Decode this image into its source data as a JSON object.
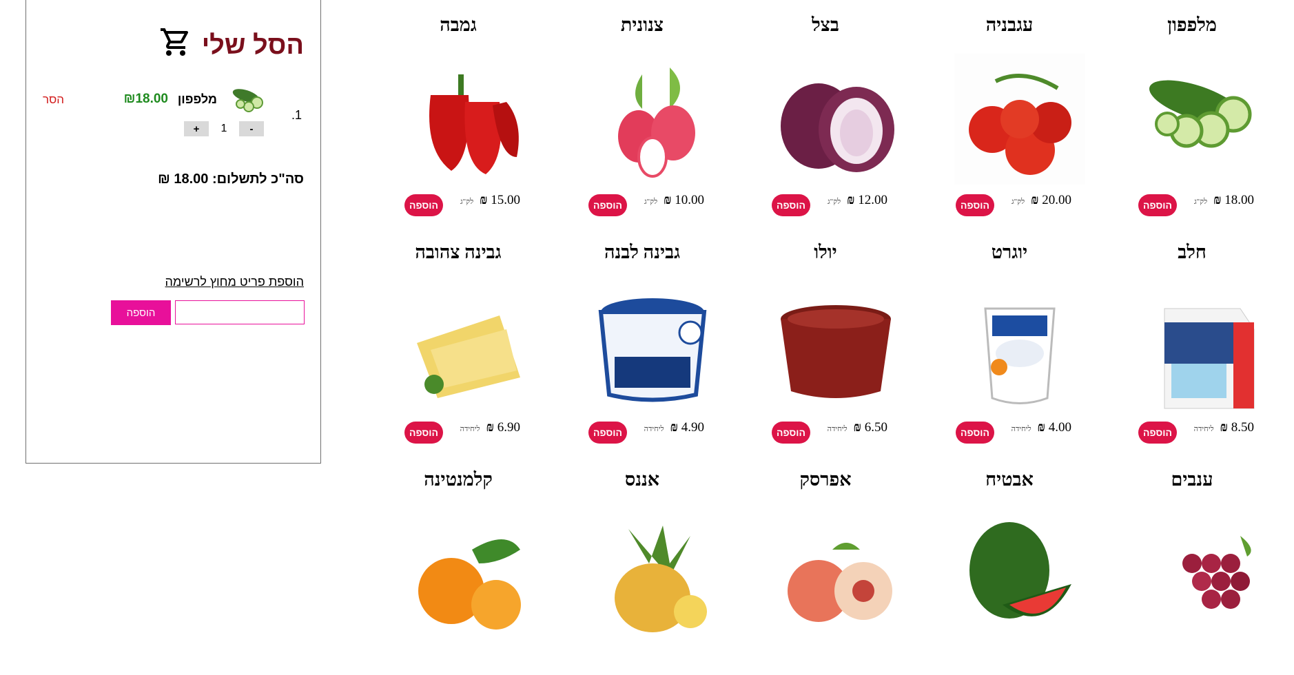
{
  "cart": {
    "title": "הסל שלי",
    "items": [
      {
        "index": "1.",
        "name": "מלפפון",
        "price": "₪18.00",
        "remove_label": "הסר",
        "quantity": "1",
        "minus": "-",
        "plus": "+"
      }
    ],
    "total_label": "סה\"כ לתשלום: 18.00 ₪",
    "extra_link": "הוספת פריט מחוץ לרשימה",
    "extra_input_value": "",
    "extra_button": "הוספה"
  },
  "currency": "₪",
  "add_label": "הוספה",
  "products": [
    {
      "name": "מלפפון",
      "price": "18.00",
      "unit": "לק\"ג",
      "icon": "cucumber-icon"
    },
    {
      "name": "עגבניה",
      "price": "20.00",
      "unit": "לק\"ג",
      "icon": "tomato-icon"
    },
    {
      "name": "בצל",
      "price": "12.00",
      "unit": "לק\"ג",
      "icon": "onion-icon"
    },
    {
      "name": "צנונית",
      "price": "10.00",
      "unit": "לק\"ג",
      "icon": "radish-icon"
    },
    {
      "name": "גמבה",
      "price": "15.00",
      "unit": "לק\"ג",
      "icon": "pepper-icon"
    },
    {
      "name": "חלב",
      "price": "8.50",
      "unit": "ליחידה",
      "icon": "milk-carton-icon"
    },
    {
      "name": "יוגרט",
      "price": "4.00",
      "unit": "ליחידה",
      "icon": "yogurt-icon"
    },
    {
      "name": "יולו",
      "price": "6.50",
      "unit": "ליחידה",
      "icon": "yolo-dessert-icon"
    },
    {
      "name": "גבינה לבנה",
      "price": "4.90",
      "unit": "ליחידה",
      "icon": "white-cheese-icon"
    },
    {
      "name": "גבינה צהובה",
      "price": "6.90",
      "unit": "ליחידה",
      "icon": "yellow-cheese-icon"
    },
    {
      "name": "ענבים",
      "price": "",
      "unit": "",
      "icon": "grapes-icon"
    },
    {
      "name": "אבטיח",
      "price": "",
      "unit": "",
      "icon": "watermelon-icon"
    },
    {
      "name": "אפרסק",
      "price": "",
      "unit": "",
      "icon": "peach-icon"
    },
    {
      "name": "אננס",
      "price": "",
      "unit": "",
      "icon": "pineapple-icon"
    },
    {
      "name": "קלמנטינה",
      "price": "",
      "unit": "",
      "icon": "clementine-icon"
    }
  ]
}
